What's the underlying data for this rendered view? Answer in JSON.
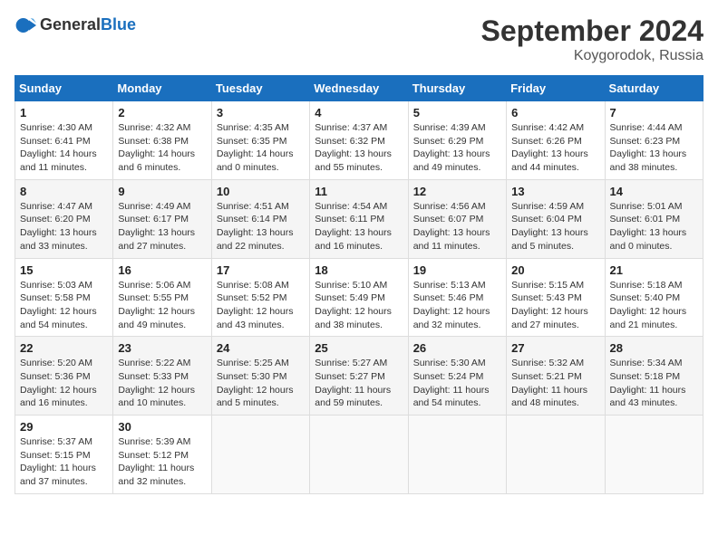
{
  "logo": {
    "general": "General",
    "blue": "Blue"
  },
  "header": {
    "month": "September 2024",
    "location": "Koygorodok, Russia"
  },
  "weekdays": [
    "Sunday",
    "Monday",
    "Tuesday",
    "Wednesday",
    "Thursday",
    "Friday",
    "Saturday"
  ],
  "weeks": [
    [
      {
        "day": "1",
        "sunrise": "4:30 AM",
        "sunset": "6:41 PM",
        "daylight": "14 hours and 11 minutes."
      },
      {
        "day": "2",
        "sunrise": "4:32 AM",
        "sunset": "6:38 PM",
        "daylight": "14 hours and 6 minutes."
      },
      {
        "day": "3",
        "sunrise": "4:35 AM",
        "sunset": "6:35 PM",
        "daylight": "14 hours and 0 minutes."
      },
      {
        "day": "4",
        "sunrise": "4:37 AM",
        "sunset": "6:32 PM",
        "daylight": "13 hours and 55 minutes."
      },
      {
        "day": "5",
        "sunrise": "4:39 AM",
        "sunset": "6:29 PM",
        "daylight": "13 hours and 49 minutes."
      },
      {
        "day": "6",
        "sunrise": "4:42 AM",
        "sunset": "6:26 PM",
        "daylight": "13 hours and 44 minutes."
      },
      {
        "day": "7",
        "sunrise": "4:44 AM",
        "sunset": "6:23 PM",
        "daylight": "13 hours and 38 minutes."
      }
    ],
    [
      {
        "day": "8",
        "sunrise": "4:47 AM",
        "sunset": "6:20 PM",
        "daylight": "13 hours and 33 minutes."
      },
      {
        "day": "9",
        "sunrise": "4:49 AM",
        "sunset": "6:17 PM",
        "daylight": "13 hours and 27 minutes."
      },
      {
        "day": "10",
        "sunrise": "4:51 AM",
        "sunset": "6:14 PM",
        "daylight": "13 hours and 22 minutes."
      },
      {
        "day": "11",
        "sunrise": "4:54 AM",
        "sunset": "6:11 PM",
        "daylight": "13 hours and 16 minutes."
      },
      {
        "day": "12",
        "sunrise": "4:56 AM",
        "sunset": "6:07 PM",
        "daylight": "13 hours and 11 minutes."
      },
      {
        "day": "13",
        "sunrise": "4:59 AM",
        "sunset": "6:04 PM",
        "daylight": "13 hours and 5 minutes."
      },
      {
        "day": "14",
        "sunrise": "5:01 AM",
        "sunset": "6:01 PM",
        "daylight": "13 hours and 0 minutes."
      }
    ],
    [
      {
        "day": "15",
        "sunrise": "5:03 AM",
        "sunset": "5:58 PM",
        "daylight": "12 hours and 54 minutes."
      },
      {
        "day": "16",
        "sunrise": "5:06 AM",
        "sunset": "5:55 PM",
        "daylight": "12 hours and 49 minutes."
      },
      {
        "day": "17",
        "sunrise": "5:08 AM",
        "sunset": "5:52 PM",
        "daylight": "12 hours and 43 minutes."
      },
      {
        "day": "18",
        "sunrise": "5:10 AM",
        "sunset": "5:49 PM",
        "daylight": "12 hours and 38 minutes."
      },
      {
        "day": "19",
        "sunrise": "5:13 AM",
        "sunset": "5:46 PM",
        "daylight": "12 hours and 32 minutes."
      },
      {
        "day": "20",
        "sunrise": "5:15 AM",
        "sunset": "5:43 PM",
        "daylight": "12 hours and 27 minutes."
      },
      {
        "day": "21",
        "sunrise": "5:18 AM",
        "sunset": "5:40 PM",
        "daylight": "12 hours and 21 minutes."
      }
    ],
    [
      {
        "day": "22",
        "sunrise": "5:20 AM",
        "sunset": "5:36 PM",
        "daylight": "12 hours and 16 minutes."
      },
      {
        "day": "23",
        "sunrise": "5:22 AM",
        "sunset": "5:33 PM",
        "daylight": "12 hours and 10 minutes."
      },
      {
        "day": "24",
        "sunrise": "5:25 AM",
        "sunset": "5:30 PM",
        "daylight": "12 hours and 5 minutes."
      },
      {
        "day": "25",
        "sunrise": "5:27 AM",
        "sunset": "5:27 PM",
        "daylight": "11 hours and 59 minutes."
      },
      {
        "day": "26",
        "sunrise": "5:30 AM",
        "sunset": "5:24 PM",
        "daylight": "11 hours and 54 minutes."
      },
      {
        "day": "27",
        "sunrise": "5:32 AM",
        "sunset": "5:21 PM",
        "daylight": "11 hours and 48 minutes."
      },
      {
        "day": "28",
        "sunrise": "5:34 AM",
        "sunset": "5:18 PM",
        "daylight": "11 hours and 43 minutes."
      }
    ],
    [
      {
        "day": "29",
        "sunrise": "5:37 AM",
        "sunset": "5:15 PM",
        "daylight": "11 hours and 37 minutes."
      },
      {
        "day": "30",
        "sunrise": "5:39 AM",
        "sunset": "5:12 PM",
        "daylight": "11 hours and 32 minutes."
      },
      null,
      null,
      null,
      null,
      null
    ]
  ],
  "labels": {
    "sunrise": "Sunrise: ",
    "sunset": "Sunset: ",
    "daylight": "Daylight: "
  }
}
